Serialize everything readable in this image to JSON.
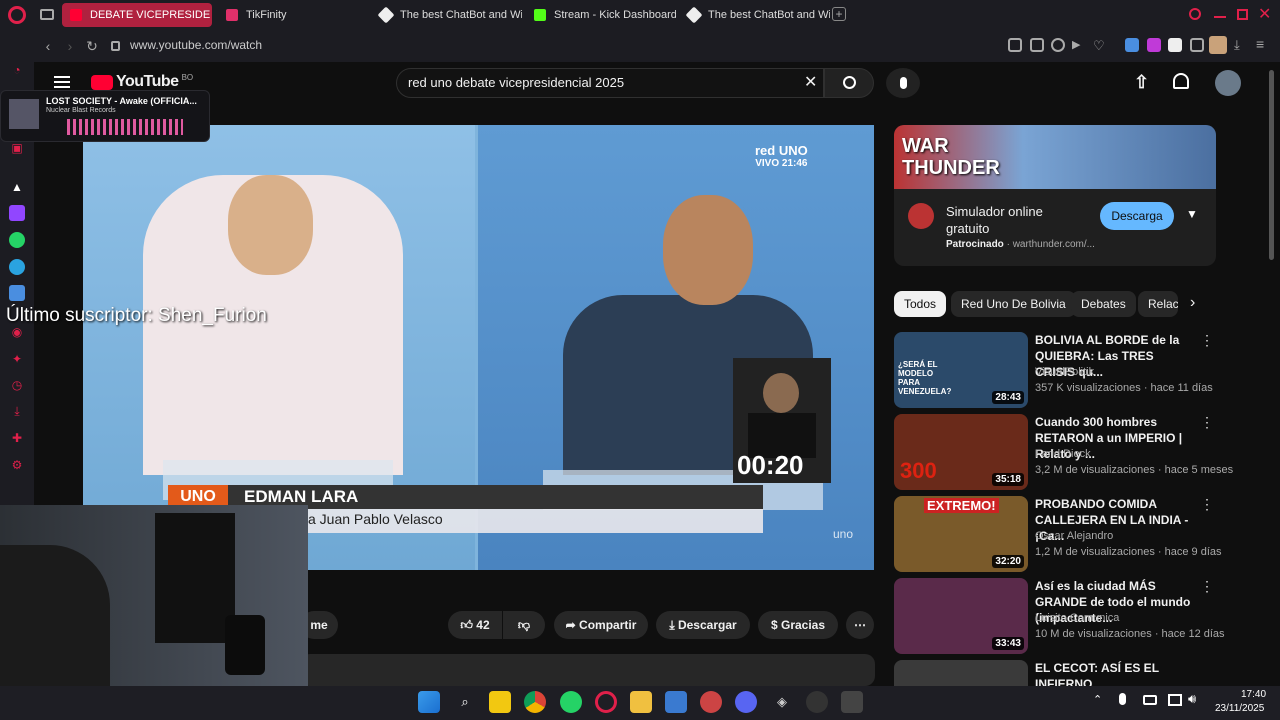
{
  "browser": {
    "tabs": [
      {
        "label": "DEBATE VICEPRESIDE",
        "active": true
      },
      {
        "label": "TikFinity"
      },
      {
        "label": "The best ChatBot and Wi"
      },
      {
        "label": "Stream - Kick Dashboard"
      },
      {
        "label": "The best ChatBot and Wi"
      }
    ],
    "url": "www.youtube.com/watch"
  },
  "youtube": {
    "logo": "YouTube",
    "logo_region": "BO",
    "search_query": "red uno debate vicepresidencial 2025"
  },
  "video": {
    "channel_bug": "red UNO",
    "live": "VIVO 21:46",
    "timer": "00:20",
    "lower_third_tag": "UNO",
    "name": "EDMAN LARA",
    "subtitle": "a Juan Pablo Velasco",
    "watermark": "uno"
  },
  "actions": {
    "likes": "42",
    "share": "Compartir",
    "download": "Descargar",
    "thanks": "Gracias",
    "subscribe_partial": "me"
  },
  "ad": {
    "banner_text": "WAR THUNDER",
    "title": "Simulador online gratuito",
    "sponsored": "Patrocinado",
    "domain": "warthunder.com/...",
    "cta": "Descarga"
  },
  "chips": [
    "Todos",
    "Red Uno De Bolivia",
    "Debates",
    "Relac"
  ],
  "recommendations": [
    {
      "title": "BOLIVIA AL BORDE de la QUIEBRA: Las TRES CRISIS qu...",
      "channel": "VisualPolitik",
      "meta": "357 K visualizaciones · hace 11 días",
      "duration": "28:43",
      "thumb_text": "¿SERÁ EL MODELO PARA VENEZUELA?",
      "color": "#2b4a6a"
    },
    {
      "title": "Cuando 300 hombres RETARON a un IMPERIO | Relato y ...",
      "channel": "Farid Dieck",
      "meta": "3,2 M de visualizaciones · hace 5 meses",
      "duration": "35:18",
      "thumb_text": "300",
      "color": "#6a2a1a"
    },
    {
      "title": "PROBANDO COMIDA CALLEJERA EN LA INDIA - ¡Ca...",
      "channel": "Oscar Alejandro",
      "meta": "1,2 M de visualizaciones · hace 9 días",
      "duration": "32:20",
      "thumb_text": "EXTREMO!",
      "color": "#7a5a2a"
    },
    {
      "title": "Así es la ciudad MÁS GRANDE de todo el mundo (impactante...",
      "channel": "Luisito Comunica",
      "meta": "10 M de visualizaciones · hace 12 días",
      "duration": "33:43",
      "thumb_text": "",
      "color": "#5a2a4a"
    },
    {
      "title": "EL CECOT: ASÍ ES EL INFIERNO",
      "channel": "",
      "meta": "",
      "duration": "",
      "thumb_text": "",
      "color": "#3a3a3a"
    }
  ],
  "overlay": {
    "subscriber": "Último suscriptor: Shen_Furion",
    "music_title": "LOST SOCIETY - Awake (OFFICIA...",
    "music_artist": "Nuclear Blast Records"
  },
  "taskbar": {
    "time": "17:40",
    "date": "23/11/2025"
  }
}
